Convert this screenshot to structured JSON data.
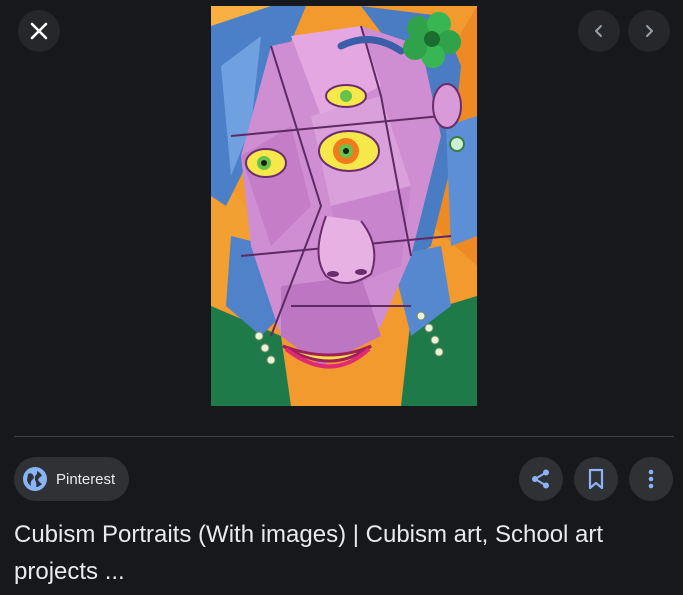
{
  "viewer": {
    "image_alt": "Cubism portrait drawing of a woman with blue hair and a green flower",
    "source": {
      "label": "Pinterest",
      "icon": "globe-icon"
    },
    "title": "Cubism Portraits (With images) | Cubism art, School art projects ...",
    "icons": {
      "close": "close-icon",
      "prev": "chevron-left-icon",
      "next": "chevron-right-icon",
      "share": "share-icon",
      "save": "bookmark-icon",
      "more": "more-vertical-icon"
    },
    "colors": {
      "background": "#17181b",
      "accent": "#8ab4f8"
    }
  }
}
